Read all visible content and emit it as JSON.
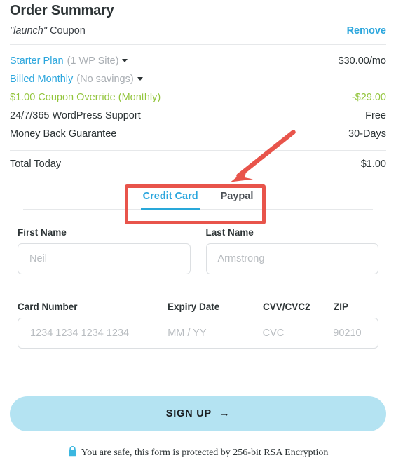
{
  "header": {
    "title": "Order Summary",
    "coupon_code": "\"launch\"",
    "coupon_word": "Coupon",
    "remove_label": "Remove"
  },
  "line_items": [
    {
      "name": "Starter Plan",
      "sub": "(1 WP Site)",
      "caret": "chevron-down-icon",
      "value": "$30.00/mo",
      "style": "link"
    },
    {
      "name": "Billed Monthly",
      "sub": "(No savings)",
      "caret": "chevron-down-icon",
      "value": "",
      "style": "link"
    },
    {
      "name": "$1.00 Coupon Override (Monthly)",
      "sub": "",
      "caret": "",
      "value": "-$29.00",
      "style": "green"
    },
    {
      "name": "24/7/365 WordPress Support",
      "sub": "",
      "caret": "",
      "value": "Free",
      "style": "plain"
    },
    {
      "name": "Money Back Guarantee",
      "sub": "",
      "caret": "",
      "value": "30-Days",
      "style": "plain"
    }
  ],
  "total": {
    "label": "Total Today",
    "value": "$1.00"
  },
  "tabs": [
    {
      "label": "Credit Card",
      "active": true
    },
    {
      "label": "Paypal",
      "active": false
    }
  ],
  "form": {
    "first_name": {
      "label": "First Name",
      "placeholder": "Neil",
      "value": ""
    },
    "last_name": {
      "label": "Last Name",
      "placeholder": "Armstrong",
      "value": ""
    },
    "card_number": {
      "label": "Card Number",
      "placeholder": "1234 1234 1234 1234",
      "value": ""
    },
    "expiry": {
      "label": "Expiry Date",
      "placeholder": "MM / YY",
      "value": ""
    },
    "cvv": {
      "label": "CVV/CVC2",
      "placeholder": "CVC",
      "value": ""
    },
    "zip": {
      "label": "ZIP",
      "placeholder": "90210",
      "value": ""
    }
  },
  "signup": {
    "label": "SIGN UP",
    "arrow": "→"
  },
  "secure": {
    "icon": "lock-icon",
    "text": "You are safe, this form is protected by 256-bit RSA Encryption"
  },
  "annotation": {
    "arrow": "red-arrow",
    "box": "red-highlight-box"
  },
  "colors": {
    "accent_blue": "#2ba6dd",
    "green": "#93c53d",
    "button_blue": "#b4e3f2",
    "annotation_red": "#e8544b",
    "text_dark": "#2d3436",
    "muted": "#a9aeb3"
  }
}
